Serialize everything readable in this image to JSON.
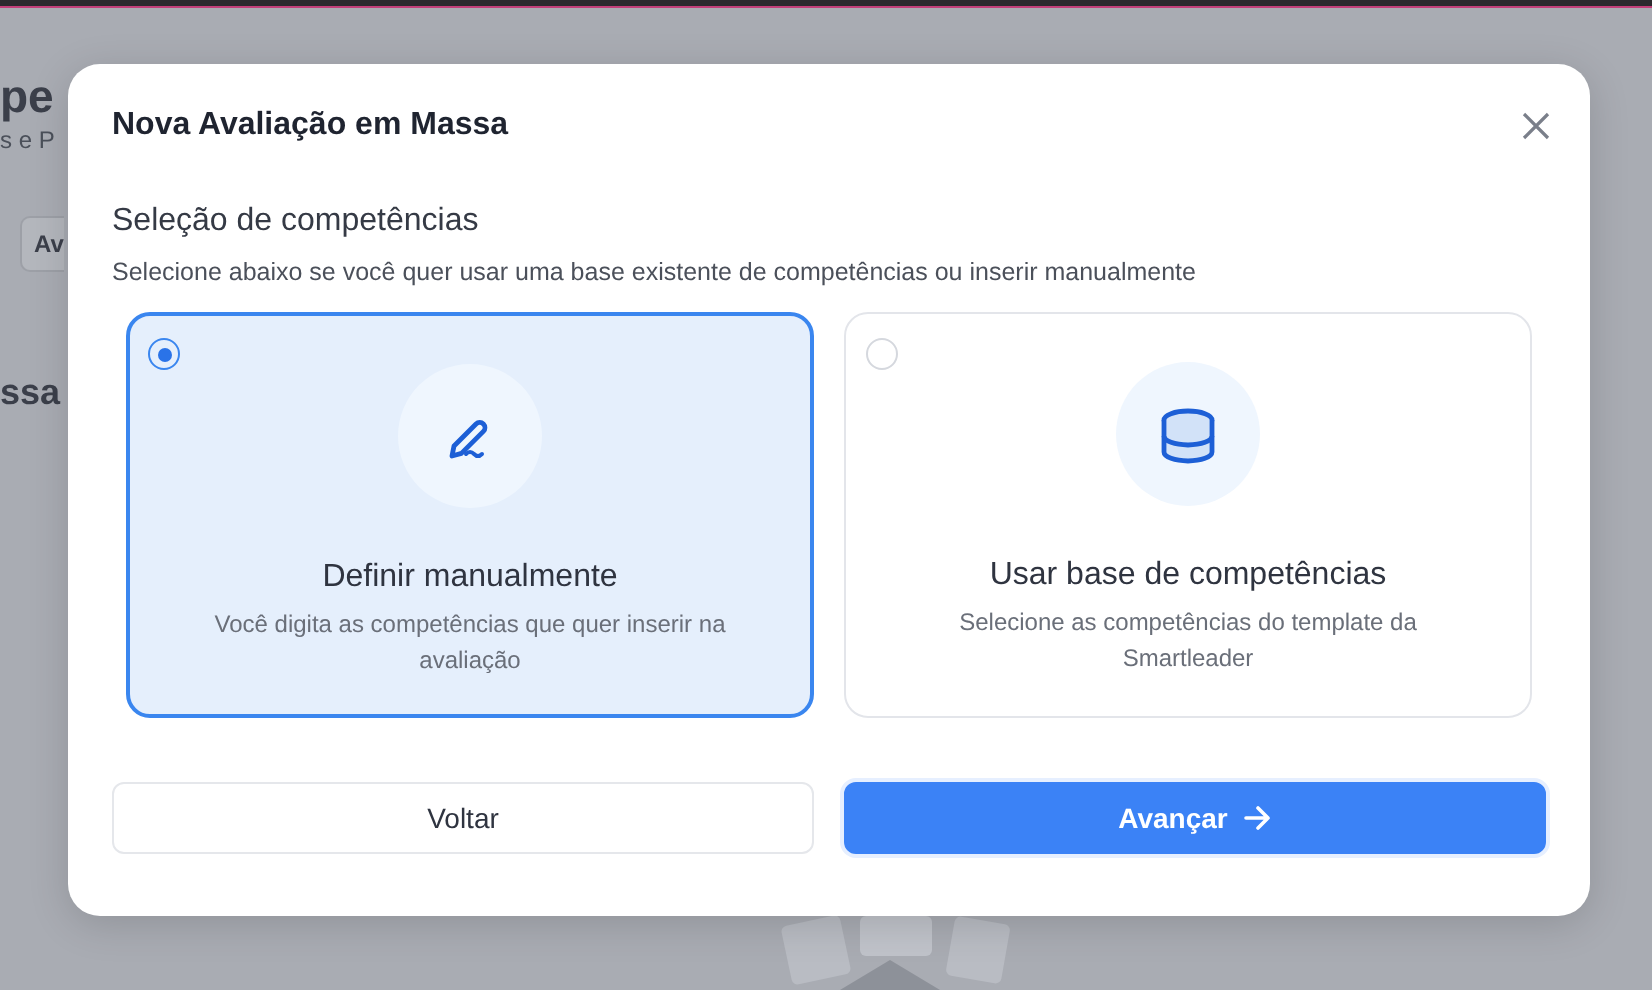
{
  "background": {
    "texts": [
      {
        "kind": "heading",
        "text": "pe"
      },
      {
        "kind": "subtitle",
        "text": "s e P"
      },
      {
        "kind": "button",
        "text": "Av"
      },
      {
        "kind": "section",
        "text": "ssa"
      }
    ]
  },
  "dialog": {
    "title": "Nova Avaliação em Massa",
    "section_title": "Seleção de competências",
    "description": "Selecione abaixo se você quer usar uma base existente de competências ou inserir manualmente",
    "options": [
      {
        "kind": "manual",
        "title": "Definir manualmente",
        "description": "Você digita as competências que quer inserir na avaliação",
        "selected": true
      },
      {
        "kind": "base",
        "title": "Usar base de competências",
        "description": "Selecione as competências do template da Smartleader",
        "selected": false
      }
    ],
    "buttons": [
      {
        "kind": "secondary",
        "label": "Voltar"
      },
      {
        "kind": "primary",
        "label": "Avançar"
      }
    ]
  }
}
